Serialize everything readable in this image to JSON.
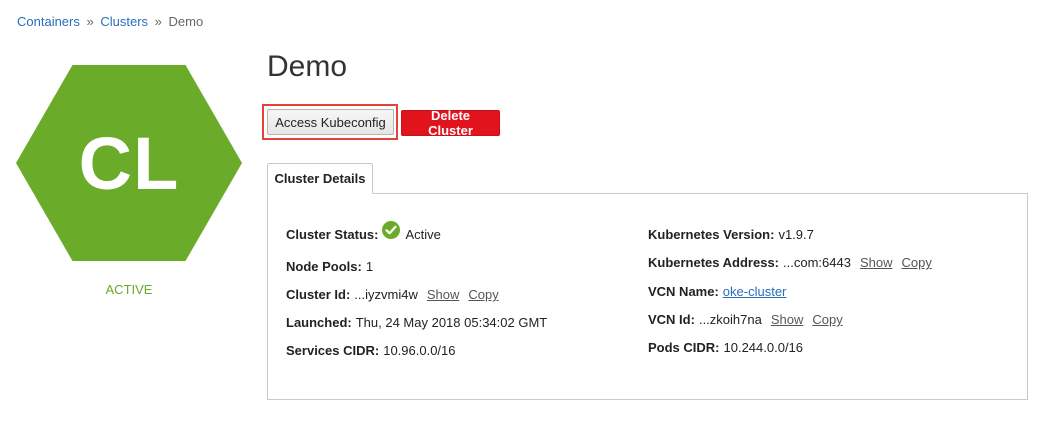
{
  "breadcrumb": {
    "containers": "Containers",
    "clusters": "Clusters",
    "current": "Demo",
    "separator": "»"
  },
  "hexagon": {
    "initials": "CL",
    "color": "#6aab2a"
  },
  "state_label": "ACTIVE",
  "title": "Demo",
  "buttons": {
    "access_kubeconfig": "Access Kubeconfig",
    "delete_cluster": "Delete Cluster"
  },
  "tabs": [
    {
      "label": "Cluster Details"
    }
  ],
  "details_left": {
    "cluster_status": {
      "label": "Cluster Status:",
      "value": "Active",
      "icon": "check-circle-icon"
    },
    "node_pools": {
      "label": "Node Pools:",
      "value": "1"
    },
    "cluster_id": {
      "label": "Cluster Id:",
      "value": "...iyzvmi4w",
      "show": "Show",
      "copy": "Copy"
    },
    "launched": {
      "label": "Launched:",
      "value": "Thu, 24 May 2018 05:34:02 GMT"
    },
    "services_cidr": {
      "label": "Services CIDR:",
      "value": "10.96.0.0/16"
    }
  },
  "details_right": {
    "kubernetes_version": {
      "label": "Kubernetes Version:",
      "value": "v1.9.7"
    },
    "kubernetes_address": {
      "label": "Kubernetes Address:",
      "value": "...com:6443",
      "show": "Show",
      "copy": "Copy"
    },
    "vcn_name": {
      "label": "VCN Name:",
      "value": "oke-cluster"
    },
    "vcn_id": {
      "label": "VCN Id:",
      "value": "...zkoih7na",
      "show": "Show",
      "copy": "Copy"
    },
    "pods_cidr": {
      "label": "Pods CIDR:",
      "value": "10.244.0.0/16"
    }
  },
  "colors": {
    "accent_green": "#6aab2a",
    "danger_red": "#e1141e",
    "link_blue": "#2a6ebb",
    "highlight_red": "#e0443c"
  }
}
